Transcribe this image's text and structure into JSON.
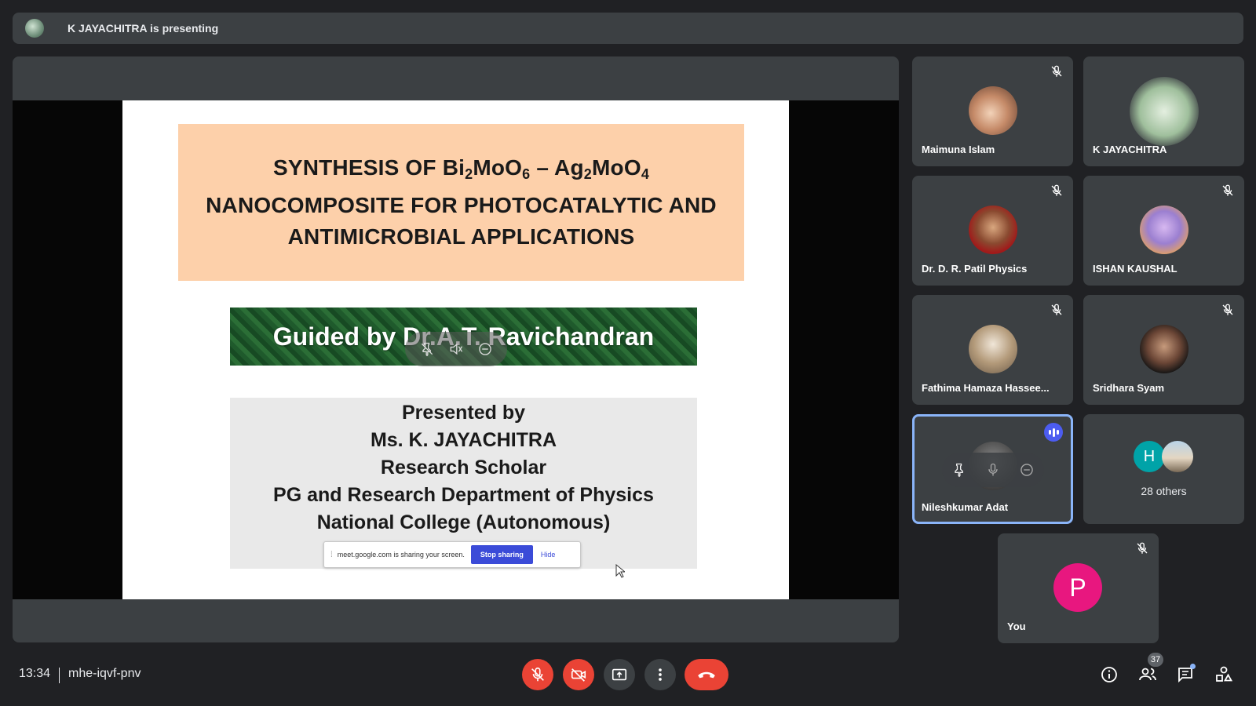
{
  "banner": {
    "text": "K JAYACHITRA is presenting"
  },
  "slide": {
    "title_line1_a": "SYNTHESIS OF Bi",
    "title_sub1": "2",
    "title_line1_b": "MoO",
    "title_sub2": "6",
    "title_line1_c": " – Ag",
    "title_sub3": "2",
    "title_line1_d": "MoO",
    "title_sub4": "4",
    "title_line2": "NANOCOMPOSITE FOR PHOTOCATALYTIC AND",
    "title_line3": "ANTIMICROBIAL  APPLICATIONS",
    "guided": "Guided by  Dr.A.T. Ravichandran",
    "presented": [
      "Presented by",
      "Ms. K. JAYACHITRA",
      "Research Scholar",
      "PG and Research Department of Physics",
      "National College (Autonomous)"
    ]
  },
  "share_bar": {
    "message": "meet.google.com is sharing your screen.",
    "stop": "Stop sharing",
    "hide": "Hide"
  },
  "participants": [
    {
      "name": "Maimuna Islam",
      "muted": true
    },
    {
      "name": "K JAYACHITRA",
      "muted": false
    },
    {
      "name": "Dr. D. R. Patil Physics",
      "muted": true
    },
    {
      "name": "ISHAN KAUSHAL",
      "muted": true
    },
    {
      "name": "Fathima Hamaza Hassee...",
      "muted": true
    },
    {
      "name": "Sridhara Syam",
      "muted": true
    },
    {
      "name": "Nileshkumar Adat",
      "muted": false,
      "speaking": true
    },
    {
      "name": "28 others",
      "initial": "H"
    },
    {
      "name": "You",
      "initial": "P",
      "muted": true
    }
  ],
  "bottom": {
    "time": "13:34",
    "meeting_code": "mhe-iqvf-pnv",
    "people_count": "37"
  },
  "colors": {
    "end_call": "#ea4335",
    "you_avatar": "#e8177f",
    "active_border": "#8ab4f8",
    "stop_sharing": "#3b4bd8"
  }
}
